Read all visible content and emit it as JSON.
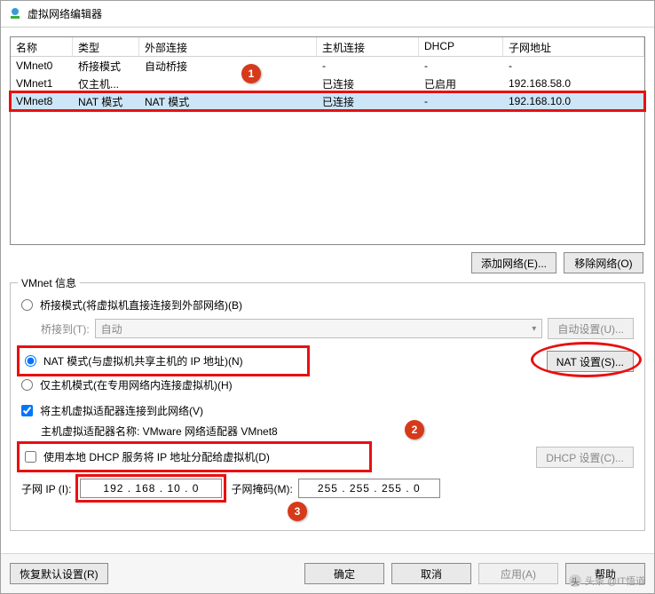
{
  "window": {
    "title": "虚拟网络编辑器"
  },
  "table": {
    "headers": {
      "name": "名称",
      "type": "类型",
      "ext": "外部连接",
      "host": "主机连接",
      "dhcp": "DHCP",
      "subnet": "子网地址"
    },
    "rows": [
      {
        "name": "VMnet0",
        "type": "桥接模式",
        "ext": "自动桥接",
        "host": "-",
        "dhcp": "-",
        "subnet": "-"
      },
      {
        "name": "VMnet1",
        "type": "仅主机...",
        "ext": "",
        "host": "已连接",
        "dhcp": "已启用",
        "subnet": "192.168.58.0"
      },
      {
        "name": "VMnet8",
        "type": "NAT 模式",
        "ext": "NAT 模式",
        "host": "已连接",
        "dhcp": "-",
        "subnet": "192.168.10.0"
      }
    ]
  },
  "buttons": {
    "add_net": "添加网络(E)...",
    "remove_net": "移除网络(O)",
    "auto_set": "自动设置(U)...",
    "nat_set": "NAT 设置(S)...",
    "dhcp_set": "DHCP 设置(C)...",
    "restore": "恢复默认设置(R)",
    "ok": "确定",
    "cancel": "取消",
    "apply": "应用(A)",
    "help": "帮助"
  },
  "group": {
    "title": "VMnet 信息",
    "bridge_radio": "桥接模式(将虚拟机直接连接到外部网络)(B)",
    "bridge_to_label": "桥接到(T):",
    "bridge_to_value": "自动",
    "nat_radio": "NAT 模式(与虚拟机共享主机的 IP 地址)(N)",
    "hostonly_radio": "仅主机模式(在专用网络内连接虚拟机)(H)",
    "connect_adapter_check": "将主机虚拟适配器连接到此网络(V)",
    "adapter_name_label": "主机虚拟适配器名称: VMware 网络适配器 VMnet8",
    "dhcp_check": "使用本地 DHCP 服务将 IP 地址分配给虚拟机(D)",
    "subnet_ip_label": "子网 IP (I):",
    "subnet_ip_value": "192 . 168 . 10 . 0",
    "subnet_mask_label": "子网掩码(M):",
    "subnet_mask_value": "255 . 255 . 255 . 0"
  },
  "badges": {
    "b1": "1",
    "b2": "2",
    "b3": "3"
  },
  "watermark": "头条 @IT悟道"
}
